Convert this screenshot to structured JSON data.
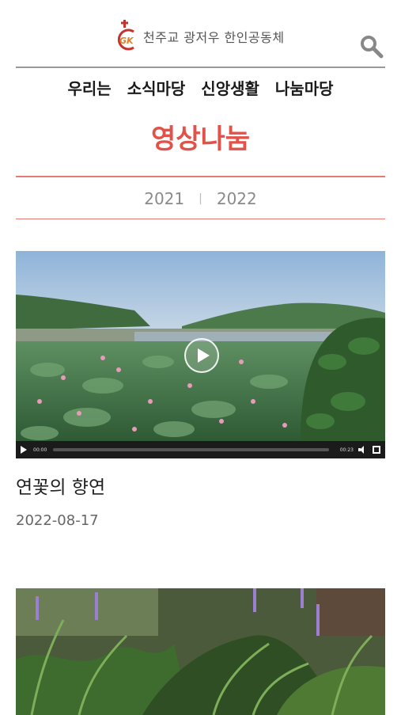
{
  "header": {
    "logo_mark": "GK",
    "logo_text_prefix": "천주교 ",
    "logo_text_name": "광저우 한인공동체",
    "search_icon": "search-icon"
  },
  "nav": {
    "items": [
      {
        "label": "우리는"
      },
      {
        "label": "소식마당"
      },
      {
        "label": "신앙생활"
      },
      {
        "label": "나눔마당"
      }
    ]
  },
  "page": {
    "title": "영상나눔",
    "accent_color": "#e0524a"
  },
  "years": {
    "items": [
      "2021",
      "2022"
    ],
    "separator": "|"
  },
  "posts": [
    {
      "title": "연꽃의 향연",
      "date": "2022-08-17",
      "player": {
        "current_time": "00:00",
        "duration": "00:23"
      }
    }
  ]
}
